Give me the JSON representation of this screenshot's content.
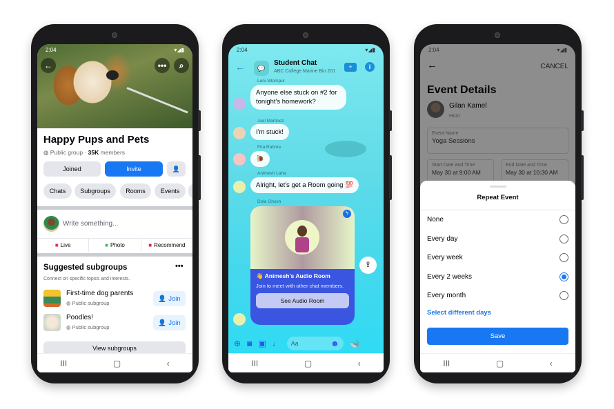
{
  "status_time": "2:04",
  "nav": {
    "recents": "III",
    "home": "▢",
    "back": "‹"
  },
  "group": {
    "title": "Happy Pups and Pets",
    "privacy": "Public group",
    "separator": "·",
    "members_count": "35K",
    "members_label": "members",
    "joined_label": "Joined",
    "invite_label": "Invite",
    "tabs": [
      "Chats",
      "Subgroups",
      "Rooms",
      "Events"
    ],
    "composer_placeholder": "Write something...",
    "actions": [
      "Live",
      "Photo",
      "Recommend"
    ],
    "suggested_title": "Suggested subgroups",
    "suggested_subtitle": "Connect on specific topics and interests.",
    "subgroups": [
      {
        "name": "First-time dog parents",
        "type": "Public subgroup",
        "join": "Join"
      },
      {
        "name": "Poodles!",
        "type": "Public subgroup",
        "join": "Join"
      }
    ],
    "view_all_label": "View subgroups",
    "accent": "#1877f2"
  },
  "chat": {
    "title": "Student Chat",
    "subtitle": "ABC College Marine Bio 201",
    "messages": [
      {
        "sender": "Leni Sitompul",
        "text": "Anyone else stuck on #2 for tonight's homework?"
      },
      {
        "sender": "Joel Martinez",
        "text": "I'm stuck!"
      },
      {
        "sender": "Fira Rahma",
        "text": "🐌"
      },
      {
        "sender": "Animesh Laha",
        "text": "Alright, let's get a Room going 💯"
      },
      {
        "sender": "Dola Ghosh",
        "text": ""
      }
    ],
    "room_card": {
      "title": "👋 Animesh's Audio Room",
      "description": "Join to meet with other chat members.",
      "button": "See Audio Room",
      "color": "#3a55e0"
    },
    "composer_placeholder": "Aa"
  },
  "event": {
    "cancel_label": "CANCEL",
    "title": "Event Details",
    "host_name": "Gilan Kamel",
    "host_role": "Host",
    "name_label": "Event Name",
    "name_value": "Yoga Sessions",
    "start_label": "Start Date and Time",
    "start_value": "May 30 at 9:00 AM",
    "end_label": "End Date and Time",
    "end_value": "May 30 at 10:30 AM",
    "sheet_title": "Repeat Event",
    "options": [
      "None",
      "Every day",
      "Every week",
      "Every 2 weeks",
      "Every month"
    ],
    "selected": "Every 2 weeks",
    "select_days_label": "Select different days",
    "save_label": "Save"
  }
}
